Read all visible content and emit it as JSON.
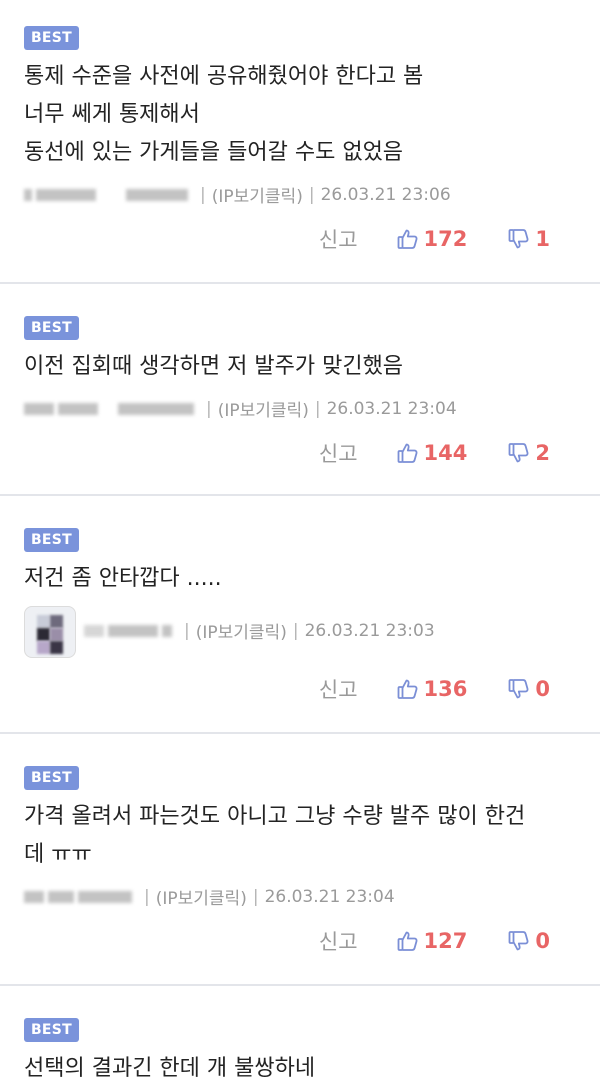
{
  "comments": [
    {
      "badge": "BEST",
      "lines": [
        "통제 수준을 사전에 공유해줬어야 한다고 봄",
        "너무 쎄게 통제해서",
        "동선에 있는 가게들을 들어갈 수도 없었음"
      ],
      "source": "(IP보기클릭)",
      "datetime": "26.03.21 23:06",
      "report": "신고",
      "likes": "172",
      "dislikes": "1"
    },
    {
      "badge": "BEST",
      "lines": [
        "이전 집회때 생각하면 저 발주가 맞긴했음"
      ],
      "source": "(IP보기클릭)",
      "datetime": "26.03.21 23:04",
      "report": "신고",
      "likes": "144",
      "dislikes": "2"
    },
    {
      "badge": "BEST",
      "lines": [
        "저건 좀 안타깝다 ....."
      ],
      "source": "(IP보기클릭)",
      "datetime": "26.03.21 23:03",
      "report": "신고",
      "likes": "136",
      "dislikes": "0"
    },
    {
      "badge": "BEST",
      "lines": [
        "가격 올려서 파는것도 아니고 그냥 수량 발주 많이 한건",
        "데 ㅠㅠ"
      ],
      "source": "(IP보기클릭)",
      "datetime": "26.03.21 23:04",
      "report": "신고",
      "likes": "127",
      "dislikes": "0"
    },
    {
      "badge": "BEST",
      "lines": [
        "선택의 결과긴 한데 개 불쌍하네"
      ]
    }
  ],
  "icons": {
    "like": "thumbs-up-icon",
    "dislike": "thumbs-down-icon"
  },
  "colors": {
    "badge": "#7a93db",
    "icon": "#7b8fd6",
    "count": "#e86565",
    "meta": "#9a9a9a",
    "divider": "#e3e5ea"
  }
}
